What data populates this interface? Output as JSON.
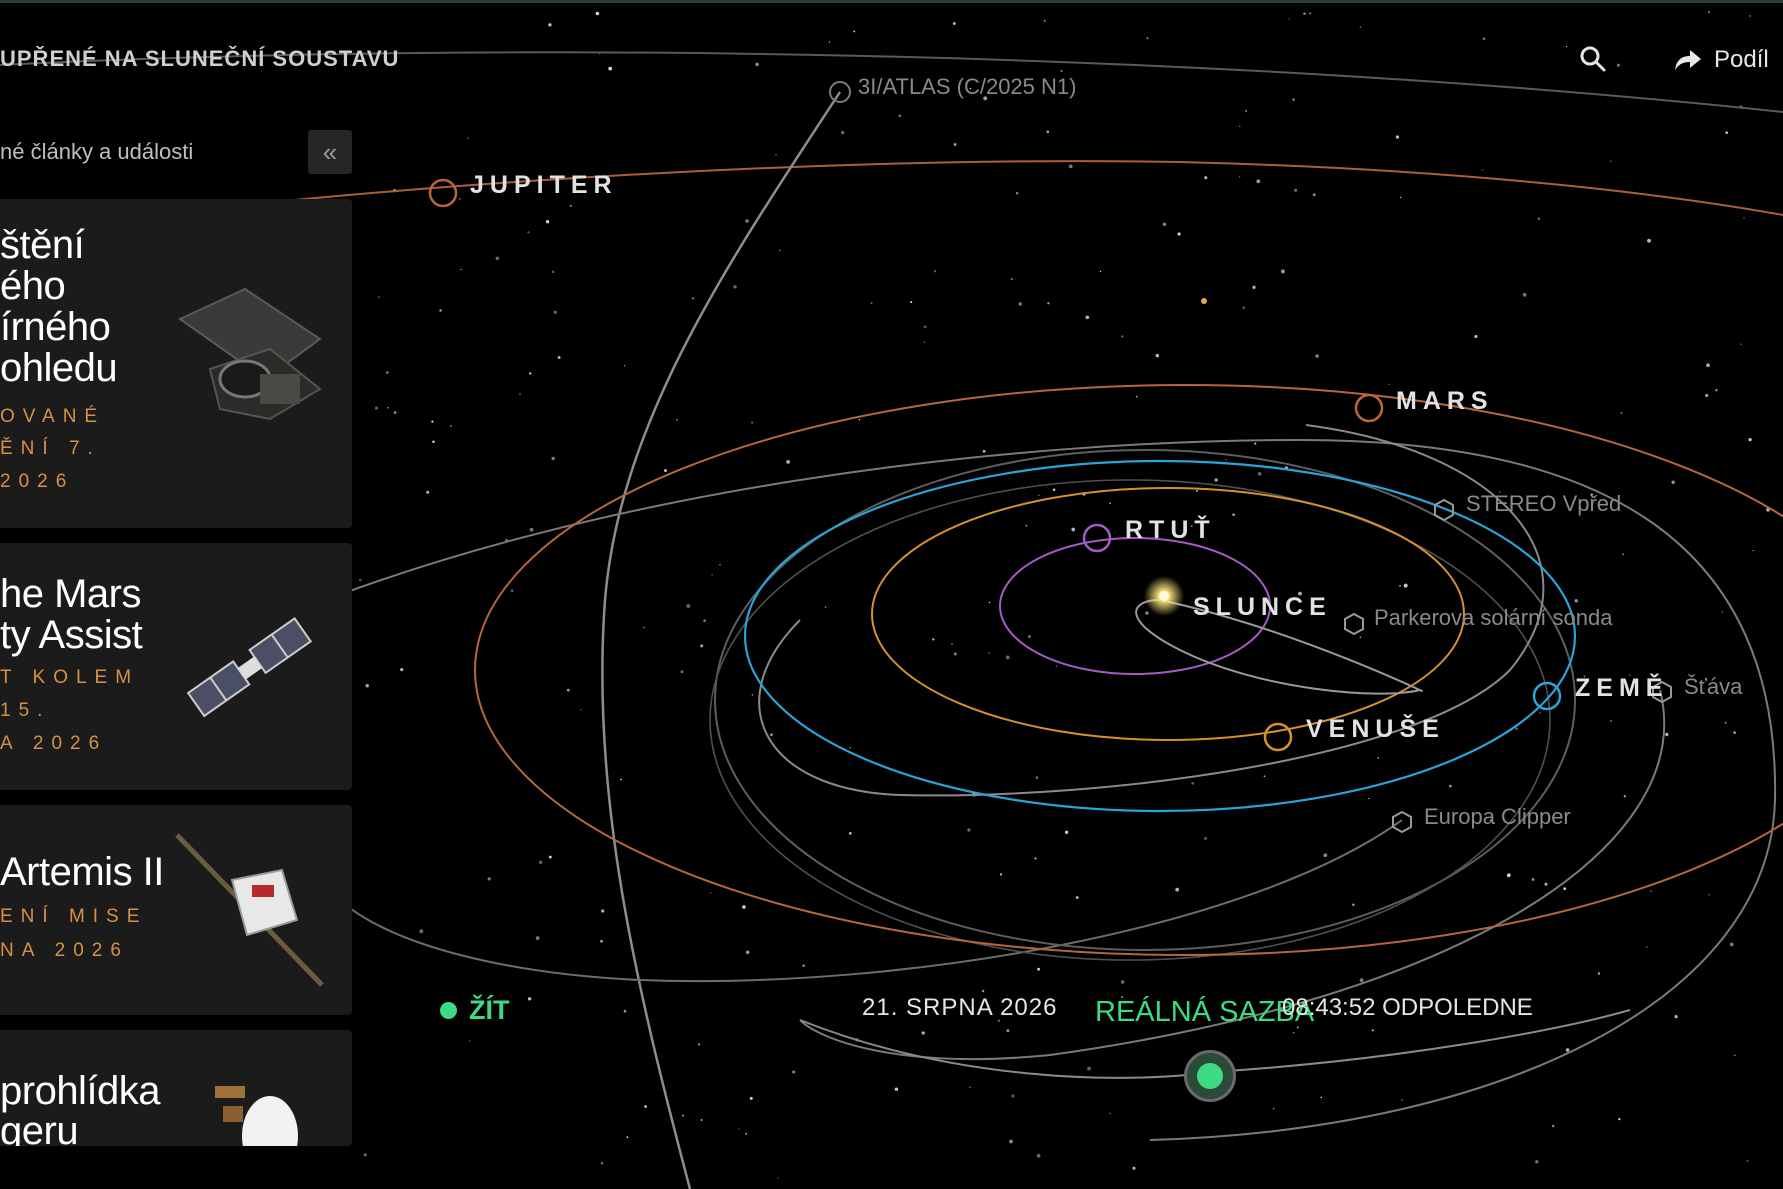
{
  "header": {
    "title": "UPŘENÉ NA SLUNEČNÍ SOUSTAVU",
    "search_icon": "search-icon",
    "share_label": "Podíl",
    "share_icon": "share-icon"
  },
  "sidebar": {
    "heading": "né články a události",
    "collapse_icon": "double-chevron-left-icon",
    "collapse_glyph": "«",
    "cards": [
      {
        "title_lines": [
          "štění",
          "ého",
          "írného",
          "ohledu"
        ],
        "subtitle_lines": [
          "OVANÉ",
          "ĚNÍ 7.",
          "2026"
        ],
        "image": "space-telescope"
      },
      {
        "title_lines": [
          "he Mars",
          "ty Assist"
        ],
        "subtitle_lines": [
          "T KOLEM",
          "15.",
          "A 2026"
        ],
        "image": "mars-flyby-spacecraft"
      },
      {
        "title_lines": [
          "Artemis II"
        ],
        "subtitle_lines": [
          "ENÍ MISE",
          "NA 2026"
        ],
        "image": "orion-capsule"
      },
      {
        "title_lines": [
          "prohlídka",
          "geru"
        ],
        "subtitle_lines": [],
        "image": "voyager-probe"
      }
    ]
  },
  "scene": {
    "planets": [
      {
        "name": "SLUNCE",
        "color": "#f6e27a"
      },
      {
        "name": "RTUŤ",
        "color": "#a55bc4"
      },
      {
        "name": "VENUŠE",
        "color": "#d8902a"
      },
      {
        "name": "ZEMĚ",
        "color": "#2aa3d6"
      },
      {
        "name": "MARS",
        "color": "#c0643a"
      },
      {
        "name": "JUPITER",
        "color": "#c0643a"
      }
    ],
    "spacecraft": [
      {
        "name": "3I/ATLAS (C/2025 N1)"
      },
      {
        "name": "STEREO Vpřed"
      },
      {
        "name": "Parkerova solární sonda"
      },
      {
        "name": "Šťáva"
      },
      {
        "name": "Europa Clipper"
      }
    ]
  },
  "timeline": {
    "live_label": "ŽÍT",
    "date": "21. SRPNA 2026",
    "rate_label": "REÁLNÁ SAZBA",
    "time": "08:43:52 ODPOLEDNE",
    "accent": "#3ddc84"
  }
}
